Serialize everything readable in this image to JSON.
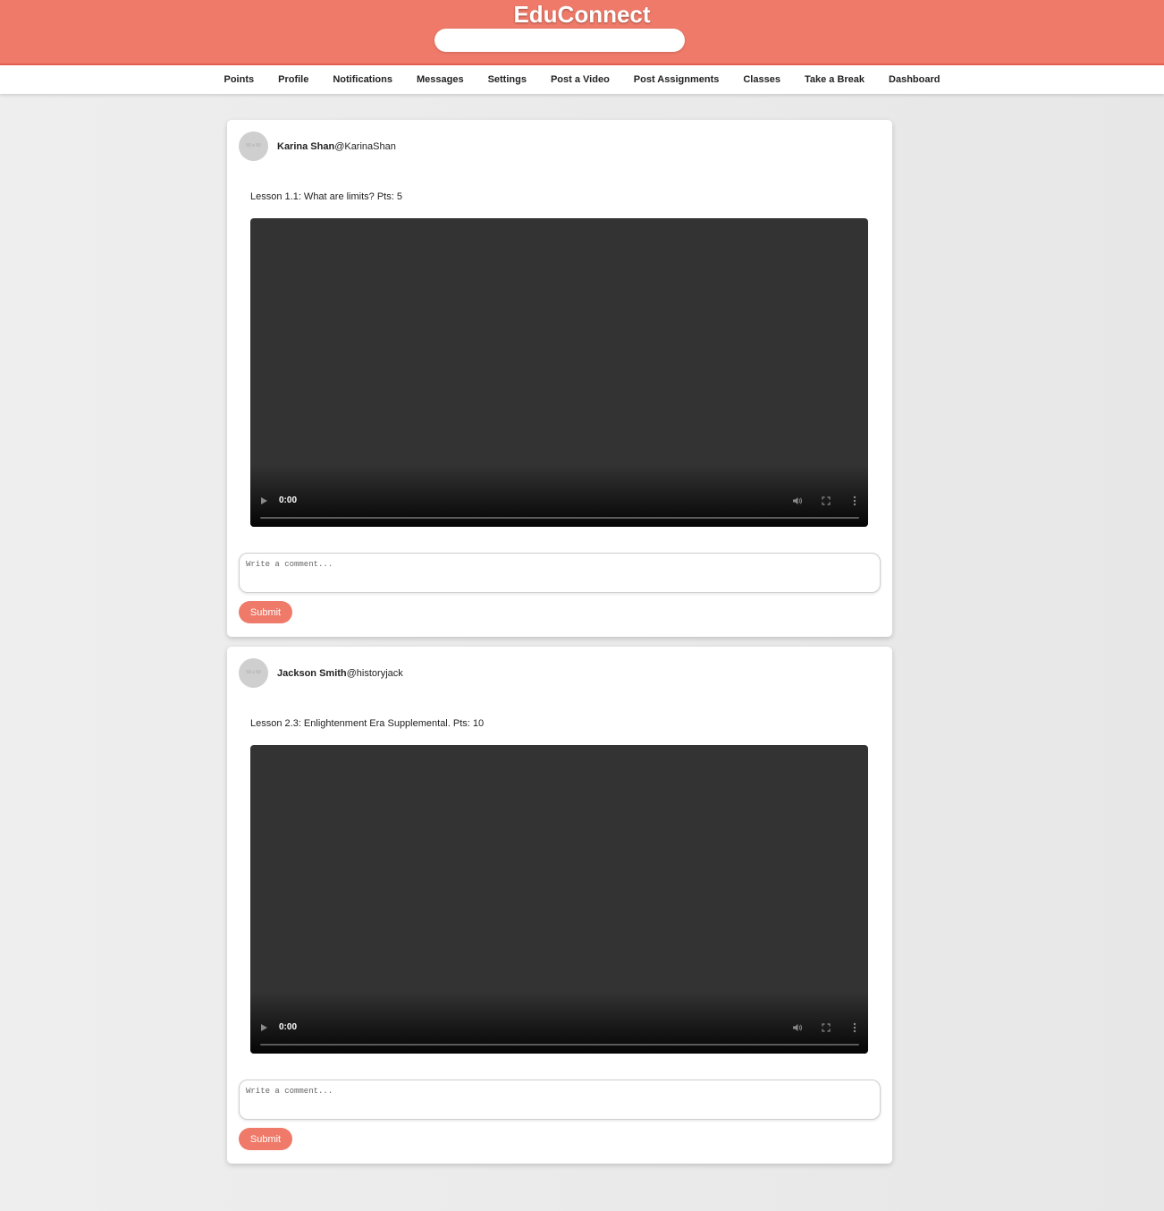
{
  "header": {
    "app_title": "EduConnect",
    "search_placeholder": "",
    "brand_color": "#ef7a69"
  },
  "nav": {
    "items": [
      {
        "label": "Points"
      },
      {
        "label": "Profile"
      },
      {
        "label": "Notifications"
      },
      {
        "label": "Messages"
      },
      {
        "label": "Settings"
      },
      {
        "label": "Post a Video"
      },
      {
        "label": "Post Assignments"
      },
      {
        "label": "Classes"
      },
      {
        "label": "Take a Break"
      },
      {
        "label": "Dashboard"
      }
    ]
  },
  "posts": [
    {
      "avatar_text": "50 x 50",
      "author_name": "Karina Shan",
      "author_handle": "@KarinaShan",
      "lesson_text": "Lesson 1.1: What are limits? Pts: 5",
      "video": {
        "time": "0:00",
        "progress": 0
      },
      "comment_placeholder": "Write a comment...",
      "submit_label": "Submit"
    },
    {
      "avatar_text": "50 x 50",
      "author_name": "Jackson Smith",
      "author_handle": "@historyjack",
      "lesson_text": "Lesson 2.3: Enlightenment Era Supplemental. Pts: 10",
      "video": {
        "time": "0:00",
        "progress": 0
      },
      "comment_placeholder": "Write a comment...",
      "submit_label": "Submit"
    }
  ]
}
